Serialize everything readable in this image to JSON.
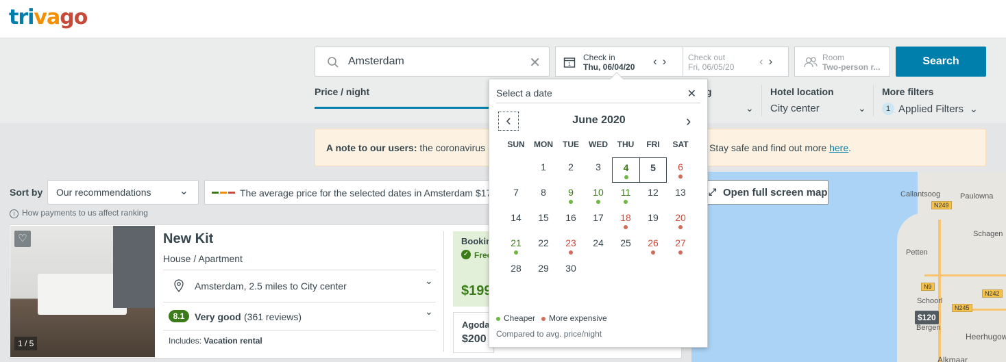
{
  "header": {
    "logo_tri": "tri",
    "logo_va": "va",
    "logo_go": "go"
  },
  "search": {
    "destination": "Amsterdam",
    "check_in_label": "Check in",
    "check_in_value": "Thu, 06/04/20",
    "check_out_label": "Check out",
    "check_out_value": "Fri, 06/05/20",
    "room_label": "Room",
    "room_value": "Two-person r...",
    "search_button": "Search"
  },
  "filters": {
    "price_label": "Price / night",
    "guest_rating_partial": "g",
    "location_label": "Hotel location",
    "location_value": "City center",
    "more_label": "More filters",
    "applied_count": "1",
    "applied_label": "Applied Filters"
  },
  "notice": {
    "bold": "A note to our users:",
    "text": " the coronavirus (",
    "tail": "Stay safe and find out more ",
    "link": "here",
    "end": "."
  },
  "sort": {
    "label": "Sort by",
    "value": "Our recommendations",
    "payments_note": "How payments to us affect ranking",
    "avg_text": "The average price for the selected dates in Amsterdam $17",
    "map_button": "Open full screen map"
  },
  "hotel": {
    "name": "New Kit",
    "type": "House / Apartment",
    "location": "Amsterdam, 2.5 miles to City center",
    "rating": "8.1",
    "rating_word": "Very good",
    "reviews": "(361 reviews)",
    "includes_label": "Includes:",
    "includes_value": "Vacation rental",
    "photo_count": "1 / 5",
    "deal1_name": "Bookin",
    "deal1_free": "Free",
    "deal1_price": "$199",
    "deal2_name": "Agoda",
    "deal2_price": "$200"
  },
  "map": {
    "price_pin": "$120",
    "labels": [
      "Paulowna",
      "Callantsoog",
      "N249",
      "Schagen",
      "Petten",
      "N9",
      "N242",
      "Schoorl",
      "N245",
      "Bergen",
      "Heerhugow",
      "Alkmaar"
    ]
  },
  "calendar": {
    "title": "Select a date",
    "month": "June 2020",
    "weekdays": [
      "SUN",
      "MON",
      "TUE",
      "WED",
      "THU",
      "FRI",
      "SAT"
    ],
    "days": [
      {
        "d": "1",
        "t": "n"
      },
      {
        "d": "2",
        "t": "n"
      },
      {
        "d": "3",
        "t": "n"
      },
      {
        "d": "4",
        "t": "cheap"
      },
      {
        "d": "5",
        "t": "n"
      },
      {
        "d": "6",
        "t": "exp"
      },
      {
        "d": "7",
        "t": "n"
      },
      {
        "d": "8",
        "t": "n"
      },
      {
        "d": "9",
        "t": "cheap"
      },
      {
        "d": "10",
        "t": "cheap"
      },
      {
        "d": "11",
        "t": "cheap"
      },
      {
        "d": "12",
        "t": "n"
      },
      {
        "d": "13",
        "t": "n"
      },
      {
        "d": "14",
        "t": "n"
      },
      {
        "d": "15",
        "t": "n"
      },
      {
        "d": "16",
        "t": "n"
      },
      {
        "d": "17",
        "t": "n"
      },
      {
        "d": "18",
        "t": "exp"
      },
      {
        "d": "19",
        "t": "n"
      },
      {
        "d": "20",
        "t": "exp"
      },
      {
        "d": "21",
        "t": "cheap"
      },
      {
        "d": "22",
        "t": "n"
      },
      {
        "d": "23",
        "t": "exp"
      },
      {
        "d": "24",
        "t": "n"
      },
      {
        "d": "25",
        "t": "n"
      },
      {
        "d": "26",
        "t": "exp"
      },
      {
        "d": "27",
        "t": "exp"
      },
      {
        "d": "28",
        "t": "n"
      },
      {
        "d": "29",
        "t": "n"
      },
      {
        "d": "30",
        "t": "n"
      }
    ],
    "legend_cheaper": "Cheaper",
    "legend_expensive": "More expensive",
    "legend_note": "Compared to avg. price/night",
    "selected_start": "4",
    "selected_end": "5"
  },
  "colors": {
    "brand_blue": "#007fad",
    "cheaper": "#6cb844",
    "expensive": "#d26b5a"
  }
}
